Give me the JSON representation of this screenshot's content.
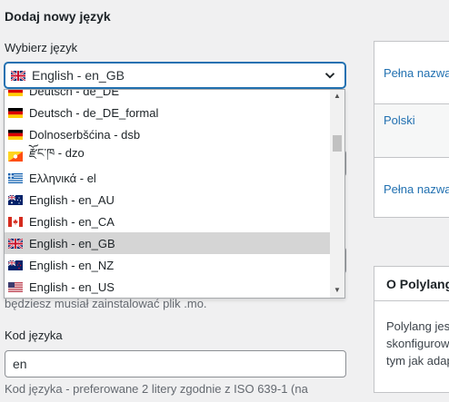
{
  "section_title": "Dodaj nowy język",
  "language_select": {
    "label": "Wybierz język",
    "selected": "English - en_GB",
    "options": [
      {
        "label": "Deutsch - de_DE",
        "flag": "de"
      },
      {
        "label": "Deutsch - de_DE_formal",
        "flag": "de"
      },
      {
        "label": "Dolnoserbšćina - dsb",
        "flag": "de"
      },
      {
        "label": "རྫོང་ཁ - dzo",
        "flag": "bt"
      },
      {
        "label": "Ελληνικά - el",
        "flag": "gr"
      },
      {
        "label": "English - en_AU",
        "flag": "au"
      },
      {
        "label": "English - en_CA",
        "flag": "ca"
      },
      {
        "label": "English - en_GB",
        "flag": "gb",
        "selected": true
      },
      {
        "label": "English - en_NZ",
        "flag": "nz"
      },
      {
        "label": "English - en_US",
        "flag": "us"
      }
    ]
  },
  "mo_help": "będziesz musiał zainstalować plik .mo.",
  "language_code": {
    "label": "Kod języka",
    "value": "en",
    "help": "Kod języka - preferowane 2 litery zgodnie z ISO 639-1 (na"
  },
  "languages_table": {
    "header": "Pełna nazwa",
    "row_name": "Polski",
    "footer": "Pełna nazwa"
  },
  "about_box": {
    "title": "O Polylang",
    "lines": [
      "Polylang jest",
      "skonfigurowany",
      "tym jak adap"
    ]
  },
  "colors": {
    "accent": "#2271b1",
    "selected_option_bg": "#d5d5d5",
    "page_bg": "#f0f0f1"
  }
}
